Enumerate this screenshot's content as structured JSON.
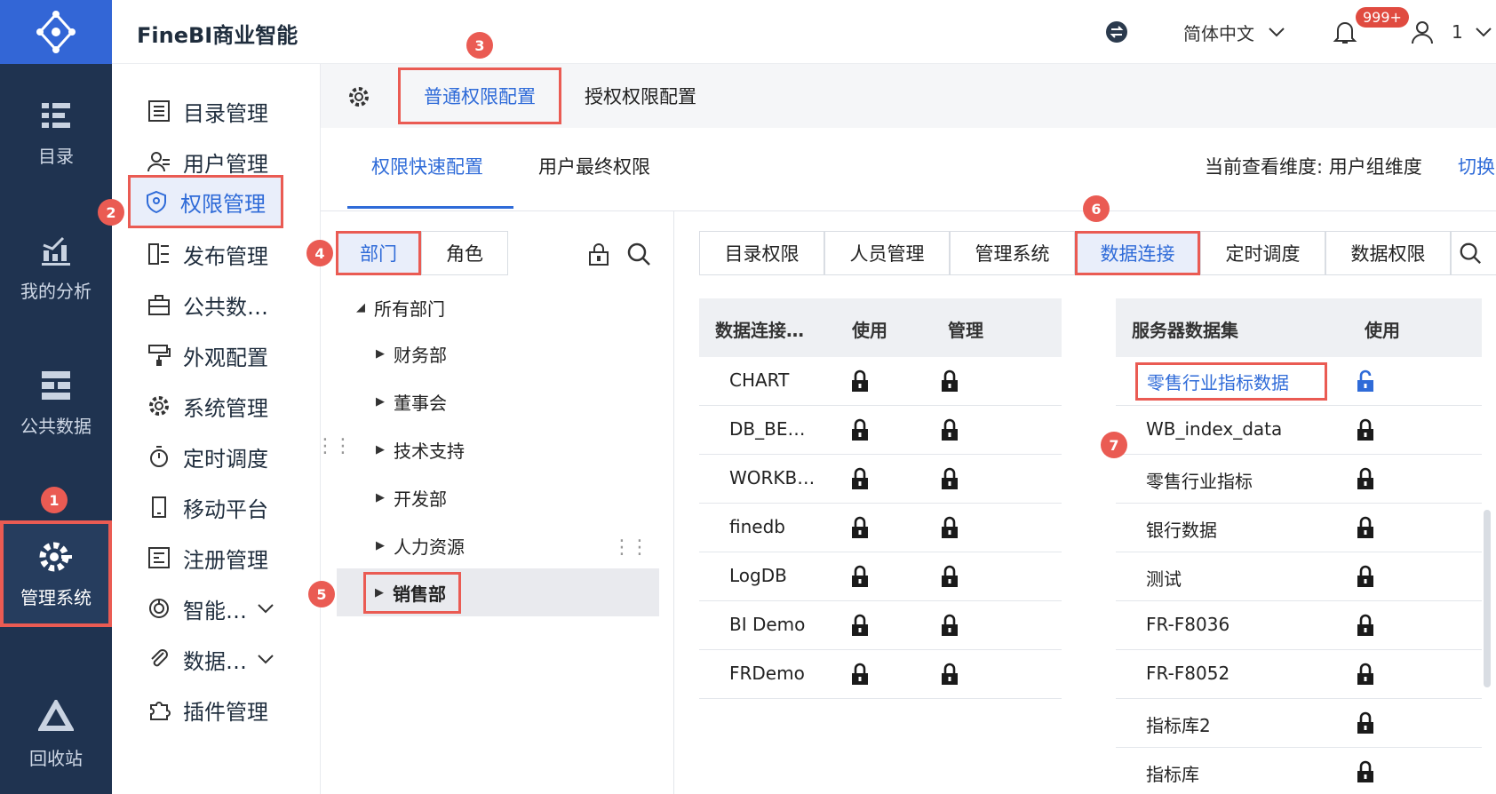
{
  "app": {
    "title": "FineBI商业智能"
  },
  "colors": {
    "accent": "#2f6bd8",
    "rail": "#1f3350",
    "logo_bg": "#3366d6",
    "highlight": "#ea5b53"
  },
  "topbar": {
    "language": "简体中文",
    "notifications": "999+",
    "user": "1"
  },
  "rail": {
    "items": [
      {
        "label": "目录",
        "icon": "catalog-icon"
      },
      {
        "label": "我的分析",
        "icon": "analysis-chart-icon"
      },
      {
        "label": "公共数据",
        "icon": "public-data-icon"
      },
      {
        "label": "管理系统",
        "icon": "settings-gear-icon"
      },
      {
        "label": "回收站",
        "icon": "recycle-icon"
      }
    ]
  },
  "menu": {
    "items": [
      {
        "label": "目录管理",
        "icon": "list-icon"
      },
      {
        "label": "用户管理",
        "icon": "user-icon"
      },
      {
        "label": "权限管理",
        "icon": "shield-icon"
      },
      {
        "label": "发布管理",
        "icon": "publish-icon"
      },
      {
        "label": "公共数…",
        "icon": "briefcase-icon"
      },
      {
        "label": "外观配置",
        "icon": "paint-roller-icon"
      },
      {
        "label": "系统管理",
        "icon": "gear-icon"
      },
      {
        "label": "定时调度",
        "icon": "timer-icon"
      },
      {
        "label": "移动平台",
        "icon": "mobile-icon"
      },
      {
        "label": "注册管理",
        "icon": "register-icon"
      },
      {
        "label": "智能…",
        "icon": "smart-icon"
      },
      {
        "label": "数据…",
        "icon": "paperclip-icon"
      },
      {
        "label": "插件管理",
        "icon": "puzzle-icon"
      }
    ]
  },
  "content": {
    "top_tabs": [
      "普通权限配置",
      "授权权限配置"
    ],
    "sub_tabs": [
      "权限快速配置",
      "用户最终权限"
    ],
    "dimension_label": "当前查看维度: 用户组维度",
    "switch_label": "切换"
  },
  "tree": {
    "segments": [
      "部门",
      "角色"
    ],
    "root": "所有部门",
    "nodes": [
      "财务部",
      "董事会",
      "技术支持",
      "开发部",
      "人力资源",
      "销售部"
    ]
  },
  "category_tabs": [
    "目录权限",
    "人员管理",
    "管理系统",
    "数据连接",
    "定时调度",
    "数据权限"
  ],
  "conn_table": {
    "headers": [
      "数据连接…",
      "使用",
      "管理"
    ],
    "rows": [
      "CHART",
      "DB_BE…",
      "WORKB…",
      "finedb",
      "LogDB",
      "BI Demo",
      "FRDemo"
    ]
  },
  "dataset_table": {
    "headers": [
      "服务器数据集",
      "使用"
    ],
    "rows": [
      "零售行业指标数据",
      "WB_index_data",
      "零售行业指标",
      "银行数据",
      "测试",
      "FR-F8036",
      "FR-F8052",
      "指标库2",
      "指标库"
    ]
  },
  "markers": [
    "1",
    "2",
    "3",
    "4",
    "5",
    "6",
    "7"
  ]
}
